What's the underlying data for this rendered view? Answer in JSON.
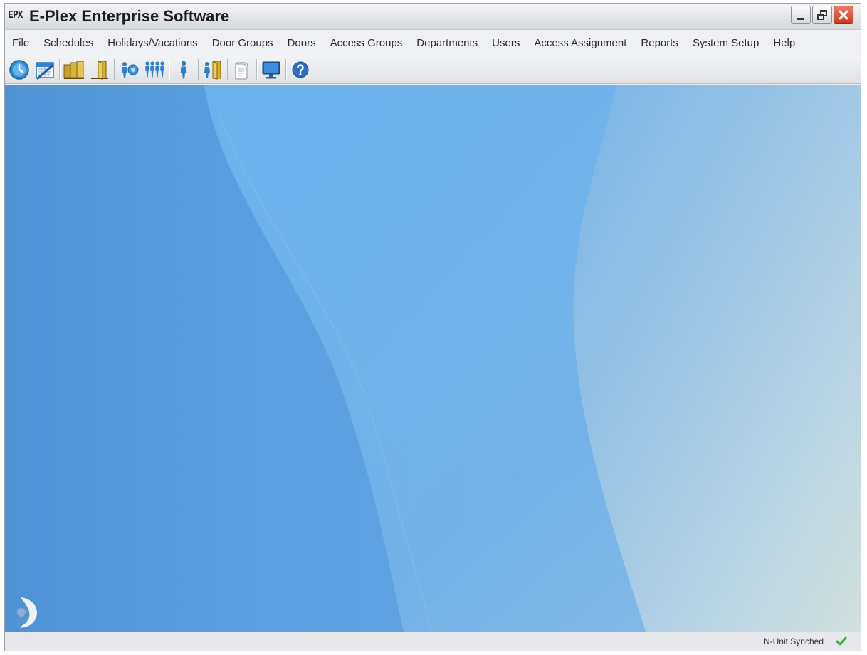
{
  "window": {
    "logo_text": "E-Plex",
    "title": "E-Plex Enterprise Software"
  },
  "window_controls": {
    "minimize_icon": "minimize-icon",
    "restore_icon": "restore-icon",
    "close_icon": "close-icon"
  },
  "menu": {
    "items": [
      "File",
      "Schedules",
      "Holidays/Vacations",
      "Door Groups",
      "Doors",
      "Access Groups",
      "Departments",
      "Users",
      "Access Assignment",
      "Reports",
      "System Setup",
      "Help"
    ]
  },
  "toolbar": {
    "icons": [
      "clock-icon",
      "calendar-icon",
      "door-groups-icon",
      "door-icon",
      "access-groups-icon",
      "departments-icon",
      "user-icon",
      "access-assignment-icon",
      "reports-icon",
      "monitor-icon",
      "help-icon"
    ]
  },
  "status": {
    "sync_text": "N-Unit Synched",
    "sync_icon": "checkmark-icon"
  },
  "colors": {
    "desktop_blue": "#5a9bd8",
    "status_check": "#3cae3c",
    "close_button": "#d9472a"
  }
}
